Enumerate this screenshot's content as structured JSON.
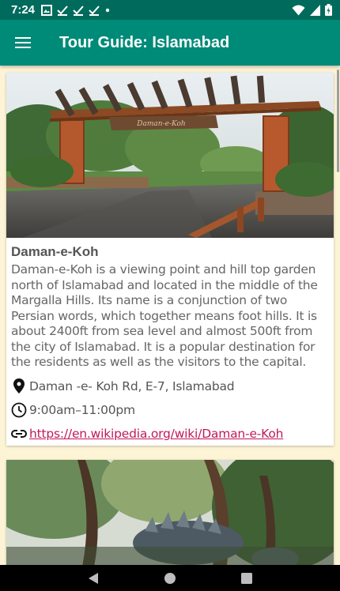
{
  "status": {
    "time": "7:24"
  },
  "app_bar": {
    "title": "Tour Guide: Islamabad"
  },
  "places": [
    {
      "name": "Daman-e-Koh",
      "description": "Daman-e-Koh is a viewing point and hill top garden north of Islamabad and located in the middle of the Margalla Hills. Its name is a conjunction of two Persian words, which together means foot hills. It is about 2400ft from sea level and almost 500ft from the city of Islamabad. It is a popular destination for the residents as well as the visitors to the capital.",
      "address": "Daman -e- Koh Rd, E-7, Islamabad",
      "hours": "9:00am–11:00pm",
      "link": "https://en.wikipedia.org/wiki/Daman-e-Koh",
      "sign_text": "Daman-e-Koh"
    }
  ],
  "colors": {
    "status_bar": "#006b5c",
    "app_bar": "#008a78",
    "background": "#fdf4d6",
    "link": "#c2185b"
  },
  "icons": [
    "notification-icon",
    "check-icon",
    "wifi-icon",
    "signal-icon",
    "battery-icon",
    "menu-icon",
    "location-pin-icon",
    "clock-icon",
    "link-icon",
    "back-icon",
    "home-icon",
    "recents-icon"
  ]
}
